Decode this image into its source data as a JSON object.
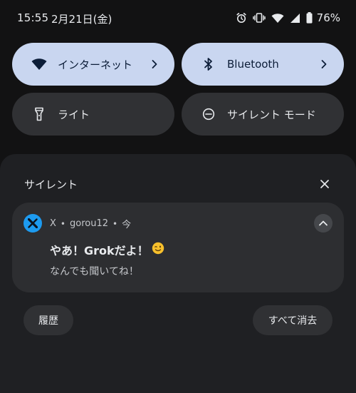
{
  "status_bar": {
    "time": "15:55",
    "date": "2月21日(金)",
    "battery": "76%",
    "icons": [
      "alarm-icon",
      "vibrate-icon",
      "wifi-icon",
      "signal-icon",
      "battery-icon"
    ]
  },
  "quick_settings": {
    "tiles": [
      {
        "label": "インターネット",
        "icon": "wifi-icon",
        "active": true,
        "has_chevron": true
      },
      {
        "label": "Bluetooth",
        "icon": "bluetooth-icon",
        "active": true,
        "has_chevron": true
      },
      {
        "label": "ライト",
        "icon": "flashlight-icon",
        "active": false,
        "has_chevron": false
      },
      {
        "label": "サイレント モード",
        "icon": "do-not-disturb-icon",
        "active": false,
        "has_chevron": false
      }
    ]
  },
  "notifications": {
    "section_title": "サイレント",
    "items": [
      {
        "app_name": "X",
        "account": "gorou12",
        "time": "今",
        "title": "やあ！Grokだよ！",
        "emoji": "😉",
        "text": "なんでも聞いてね！"
      }
    ],
    "history_label": "履歴",
    "clear_all_label": "すべて消去"
  },
  "colors": {
    "background": "#121213",
    "tile_active": "#c9d6f0",
    "tile_inactive": "#303134",
    "shade": "#1f2023",
    "card": "#2d2e31",
    "x_icon_blue": "#1d9bf0"
  }
}
